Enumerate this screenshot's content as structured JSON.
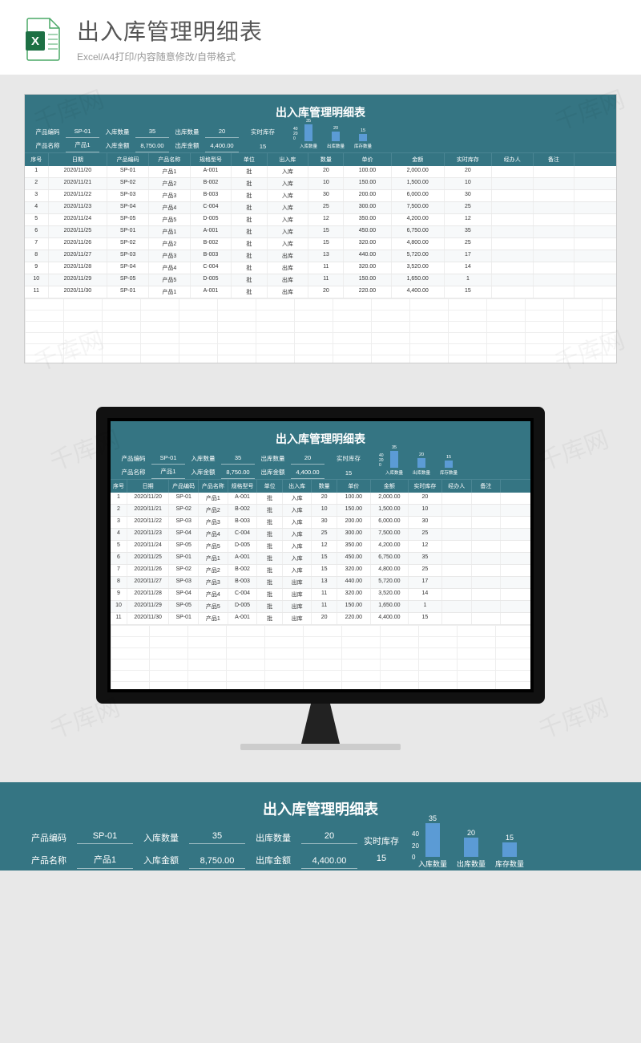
{
  "page_header": {
    "title": "出入库管理明细表",
    "subtitle": "Excel/A4打印/内容随意修改/自带格式"
  },
  "sheet": {
    "title": "出入库管理明细表",
    "summary": {
      "product_code_label": "产品编码",
      "product_code": "SP-01",
      "product_name_label": "产品名称",
      "product_name": "产品1",
      "in_qty_label": "入库数量",
      "in_qty": "35",
      "in_amt_label": "入库金额",
      "in_amt": "8,750.00",
      "out_qty_label": "出库数量",
      "out_qty": "20",
      "out_amt_label": "出库金额",
      "out_amt": "4,400.00",
      "stock_label": "实时库存",
      "stock": "15"
    },
    "columns": [
      "序号",
      "日期",
      "产品编码",
      "产品名称",
      "规格型号",
      "单位",
      "出入库",
      "数量",
      "单价",
      "金额",
      "实时库存",
      "经办人",
      "备注"
    ],
    "rows": [
      {
        "seq": "1",
        "date": "2020/11/20",
        "code": "SP-01",
        "name": "产品1",
        "spec": "A-001",
        "unit": "批",
        "io": "入库",
        "qty": "20",
        "price": "100.00",
        "amt": "2,000.00",
        "stock": "20",
        "op": "",
        "note": ""
      },
      {
        "seq": "2",
        "date": "2020/11/21",
        "code": "SP-02",
        "name": "产品2",
        "spec": "B-002",
        "unit": "批",
        "io": "入库",
        "qty": "10",
        "price": "150.00",
        "amt": "1,500.00",
        "stock": "10",
        "op": "",
        "note": ""
      },
      {
        "seq": "3",
        "date": "2020/11/22",
        "code": "SP-03",
        "name": "产品3",
        "spec": "B-003",
        "unit": "批",
        "io": "入库",
        "qty": "30",
        "price": "200.00",
        "amt": "6,000.00",
        "stock": "30",
        "op": "",
        "note": ""
      },
      {
        "seq": "4",
        "date": "2020/11/23",
        "code": "SP-04",
        "name": "产品4",
        "spec": "C-004",
        "unit": "批",
        "io": "入库",
        "qty": "25",
        "price": "300.00",
        "amt": "7,500.00",
        "stock": "25",
        "op": "",
        "note": ""
      },
      {
        "seq": "5",
        "date": "2020/11/24",
        "code": "SP-05",
        "name": "产品5",
        "spec": "D-005",
        "unit": "批",
        "io": "入库",
        "qty": "12",
        "price": "350.00",
        "amt": "4,200.00",
        "stock": "12",
        "op": "",
        "note": ""
      },
      {
        "seq": "6",
        "date": "2020/11/25",
        "code": "SP-01",
        "name": "产品1",
        "spec": "A-001",
        "unit": "批",
        "io": "入库",
        "qty": "15",
        "price": "450.00",
        "amt": "6,750.00",
        "stock": "35",
        "op": "",
        "note": ""
      },
      {
        "seq": "7",
        "date": "2020/11/26",
        "code": "SP-02",
        "name": "产品2",
        "spec": "B-002",
        "unit": "批",
        "io": "入库",
        "qty": "15",
        "price": "320.00",
        "amt": "4,800.00",
        "stock": "25",
        "op": "",
        "note": ""
      },
      {
        "seq": "8",
        "date": "2020/11/27",
        "code": "SP-03",
        "name": "产品3",
        "spec": "B-003",
        "unit": "批",
        "io": "出库",
        "qty": "13",
        "price": "440.00",
        "amt": "5,720.00",
        "stock": "17",
        "op": "",
        "note": ""
      },
      {
        "seq": "9",
        "date": "2020/11/28",
        "code": "SP-04",
        "name": "产品4",
        "spec": "C-004",
        "unit": "批",
        "io": "出库",
        "qty": "11",
        "price": "320.00",
        "amt": "3,520.00",
        "stock": "14",
        "op": "",
        "note": ""
      },
      {
        "seq": "10",
        "date": "2020/11/29",
        "code": "SP-05",
        "name": "产品5",
        "spec": "D-005",
        "unit": "批",
        "io": "出库",
        "qty": "11",
        "price": "150.00",
        "amt": "1,650.00",
        "stock": "1",
        "op": "",
        "note": ""
      },
      {
        "seq": "11",
        "date": "2020/11/30",
        "code": "SP-01",
        "name": "产品1",
        "spec": "A-001",
        "unit": "批",
        "io": "出库",
        "qty": "20",
        "price": "220.00",
        "amt": "4,400.00",
        "stock": "15",
        "op": "",
        "note": ""
      }
    ]
  },
  "chart_data": {
    "type": "bar",
    "categories": [
      "入库数量",
      "出库数量",
      "库存数量"
    ],
    "values": [
      35,
      20,
      15
    ],
    "ylim": [
      0,
      40
    ],
    "yticks": [
      0,
      20,
      40
    ],
    "title": "",
    "xlabel": "",
    "ylabel": ""
  },
  "watermark": "千库网"
}
